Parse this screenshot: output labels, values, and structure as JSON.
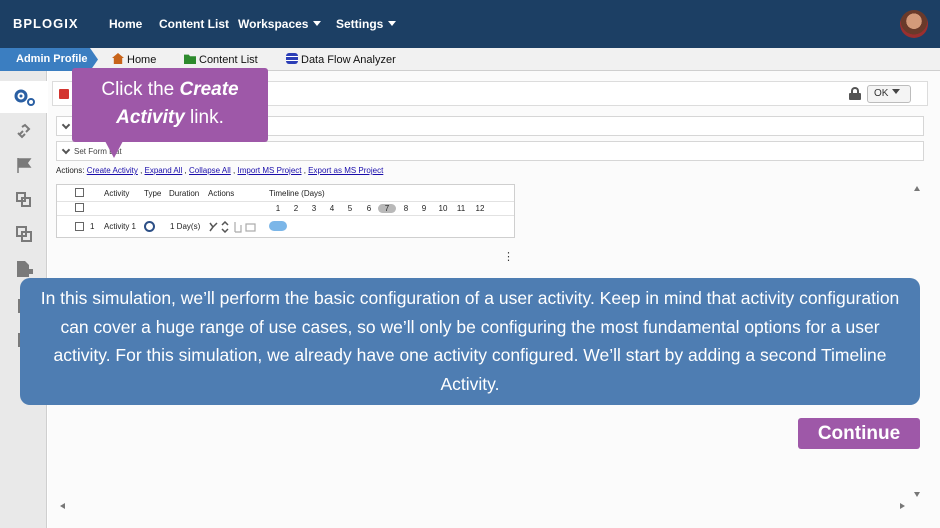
{
  "topnav": {
    "logo": "BPLOGIX",
    "home": "Home",
    "content_list": "Content List",
    "workspaces": "Workspaces",
    "settings": "Settings"
  },
  "breadcrumb": {
    "admin": "Admin Profile",
    "home": "Home",
    "content_list": "Content List",
    "data_flow": "Data Flow Analyzer"
  },
  "sidebar": {
    "icons": [
      "gears-icon",
      "link-icon",
      "flag-icon",
      "copy-icon",
      "copy-alt-icon",
      "file-lock-icon",
      "clipboard-icon",
      "clipboard-alt-icon"
    ]
  },
  "card": {
    "ok_label": "OK",
    "panel2_label": "Set Form Dat"
  },
  "actions": {
    "prefix": "Actions:",
    "links": [
      "Create Activity",
      "Expand All",
      "Collapse All",
      "Import MS Project",
      "Export as MS Project"
    ]
  },
  "table": {
    "headers": {
      "activity": "Activity",
      "type": "Type",
      "duration": "Duration",
      "actions": "Actions",
      "timeline": "Timeline (Days)"
    },
    "days": [
      "1",
      "2",
      "3",
      "4",
      "5",
      "6",
      "7",
      "8",
      "9",
      "10",
      "11",
      "12"
    ],
    "today": "7",
    "row": {
      "index": "1",
      "name": "Activity 1",
      "duration": "1 Day(s)"
    }
  },
  "callout": {
    "pre": "Click the ",
    "emph": "Create Activity",
    "post": " link."
  },
  "message": "In this simulation, we’ll perform the basic configuration of a user activity. Keep in mind that activity configuration can cover a huge range of use cases, so we’ll only be configuring the most fundamental options for a user activity. For this simulation, we already have one activity configured. We’ll start by adding a second Timeline Activity.",
  "continue_label": "Continue",
  "colors": {
    "nav_bg": "#1c3f64",
    "admin_tab": "#3b7ec1",
    "callout": "#9e58a8",
    "message_bg": "#4e7db2"
  }
}
